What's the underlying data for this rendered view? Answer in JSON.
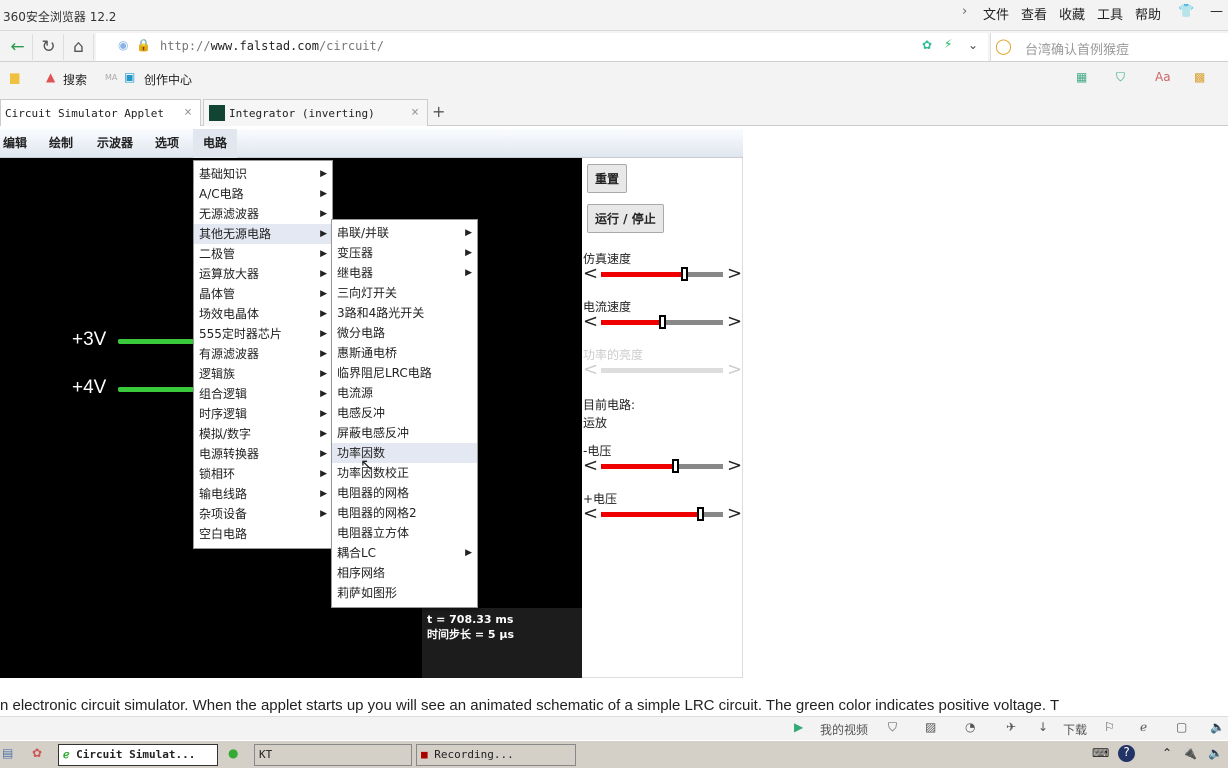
{
  "browser": {
    "title": "360安全浏览器 12.2",
    "menu": [
      "文件",
      "查看",
      "收藏",
      "工具",
      "帮助"
    ],
    "url_prefix": "http://",
    "url_host": "www.falstad.com",
    "url_path": "/circuit/",
    "search_placeholder": "台湾确认首例猴痘",
    "bookmarks": [
      "搜索",
      "MA",
      "创作中心"
    ],
    "tabs": [
      {
        "label": "Circuit Simulator Applet",
        "active": true
      },
      {
        "label": "Integrator (inverting)",
        "active": false
      }
    ],
    "new_tab": "+"
  },
  "app": {
    "menubar": [
      "编辑",
      "绘制",
      "示波器",
      "选项",
      "电路"
    ],
    "voltages": [
      "+3V",
      "+4V"
    ],
    "time": "t = 708.33 ms",
    "timestep": "时间步长 = 5 μs",
    "panel": {
      "reset": "重置",
      "run_stop": "运行 / 停止",
      "sliders": [
        {
          "label": "仿真速度",
          "value": 0.68,
          "enabled": true
        },
        {
          "label": "电流速度",
          "value": 0.5,
          "enabled": true
        },
        {
          "label": "功率的亮度",
          "value": 0,
          "enabled": false
        }
      ],
      "current_label": "目前电路:",
      "current_value": "运放",
      "voltage_sliders": [
        {
          "label": "-电压",
          "value": 0.61
        },
        {
          "label": "+电压",
          "value": 0.81
        }
      ]
    },
    "circuit_menu": [
      {
        "label": "基础知识",
        "sub": true
      },
      {
        "label": "A/C电路",
        "sub": true
      },
      {
        "label": "无源滤波器",
        "sub": true
      },
      {
        "label": "其他无源电路",
        "sub": true,
        "hl": true
      },
      {
        "label": "二极管",
        "sub": true
      },
      {
        "label": "运算放大器",
        "sub": true
      },
      {
        "label": "晶体管",
        "sub": true
      },
      {
        "label": "场效电晶体",
        "sub": true
      },
      {
        "label": "555定时器芯片",
        "sub": true
      },
      {
        "label": "有源滤波器",
        "sub": true
      },
      {
        "label": "逻辑族",
        "sub": true
      },
      {
        "label": "组合逻辑",
        "sub": true
      },
      {
        "label": "时序逻辑",
        "sub": true
      },
      {
        "label": "模拟/数字",
        "sub": true
      },
      {
        "label": "电源转换器",
        "sub": true
      },
      {
        "label": "锁相环",
        "sub": true
      },
      {
        "label": "输电线路",
        "sub": true
      },
      {
        "label": "杂项设备",
        "sub": true
      },
      {
        "label": "空白电路",
        "sub": false
      }
    ],
    "submenu": [
      {
        "label": "串联/并联",
        "sub": true
      },
      {
        "label": "变压器",
        "sub": true
      },
      {
        "label": "继电器",
        "sub": true
      },
      {
        "label": "三向灯开关"
      },
      {
        "label": "3路和4路光开关"
      },
      {
        "label": "微分电路"
      },
      {
        "label": "惠斯通电桥"
      },
      {
        "label": "临界阻尼LRC电路"
      },
      {
        "label": "电流源"
      },
      {
        "label": "电感反冲"
      },
      {
        "label": "屏蔽电感反冲"
      },
      {
        "label": "功率因数",
        "hl": true
      },
      {
        "label": "功率因数校正"
      },
      {
        "label": "电阻器的网格"
      },
      {
        "label": "电阻器的网格2"
      },
      {
        "label": "电阻器立方体"
      },
      {
        "label": "耦合LC",
        "sub": true
      },
      {
        "label": "相序网络"
      },
      {
        "label": "莉萨如图形"
      }
    ]
  },
  "body_text": "n electronic circuit simulator.  When the applet starts up you will see an animated schematic of a simple LRC circuit. The green color indicates positive voltage.  T",
  "statusbar": {
    "video": "我的视频",
    "download": "下载"
  },
  "taskbar": [
    {
      "label": "Circuit Simulat...",
      "active": true
    },
    {
      "label": "KT"
    },
    {
      "label": "Recording..."
    }
  ],
  "colors": {
    "wire": "#3ac93a",
    "slider_fill": "#e00000",
    "canvas": "#000000"
  }
}
